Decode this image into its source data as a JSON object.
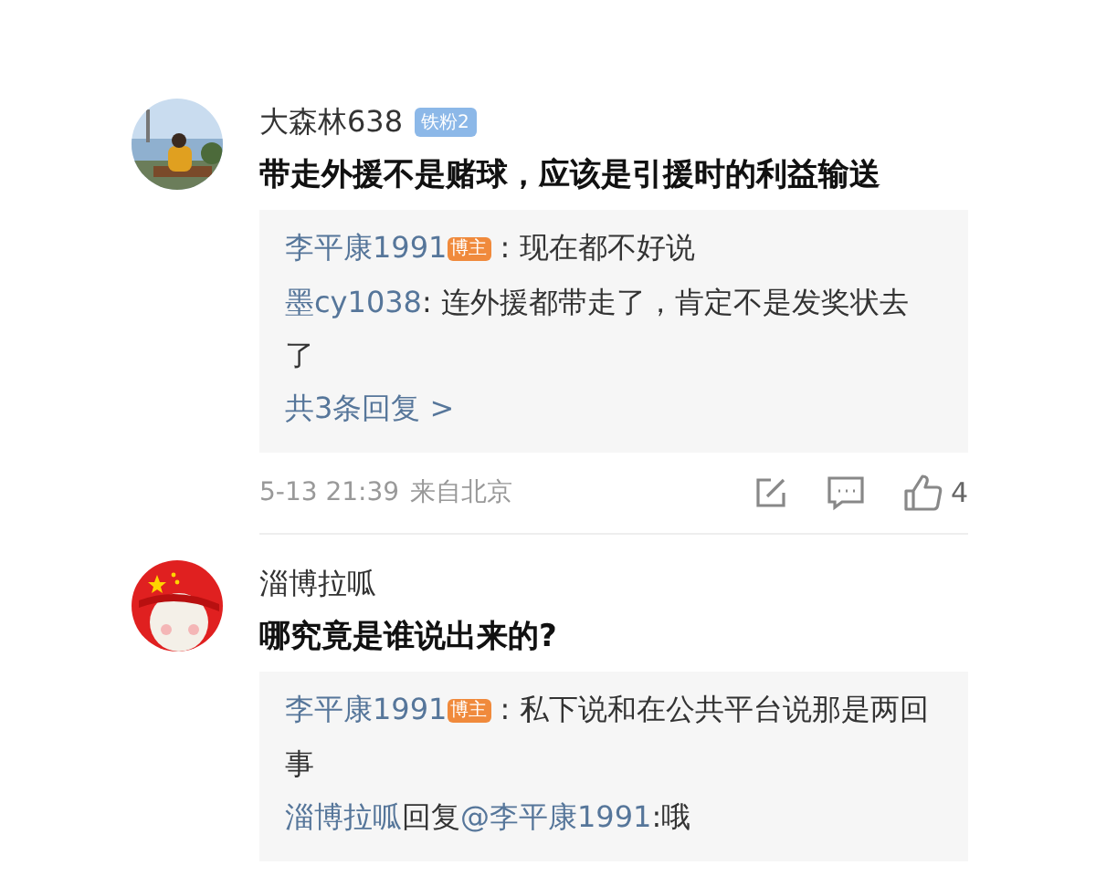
{
  "comments": [
    {
      "author": "大森林638",
      "badge": {
        "kind": "fan",
        "text": "铁粉2"
      },
      "text": "带走外援不是赌球，应该是引援时的利益输送",
      "replies": [
        {
          "segments": [
            {
              "kind": "link",
              "text": "李平康1991"
            },
            {
              "kind": "badge",
              "text": "博主"
            },
            {
              "kind": "text",
              "text": " : 现在都不好说"
            }
          ]
        },
        {
          "segments": [
            {
              "kind": "link",
              "text": "墨cy1038"
            },
            {
              "kind": "text",
              "text": ": 连外援都带走了，肯定不是发奖状去了"
            }
          ]
        }
      ],
      "more_replies": "共3条回复 >",
      "time": "5-13 21:39",
      "location": "来自北京",
      "likes": "4"
    },
    {
      "author": "淄博拉呱",
      "text": "哪究竟是谁说出来的?",
      "replies": [
        {
          "segments": [
            {
              "kind": "link",
              "text": "李平康1991"
            },
            {
              "kind": "badge",
              "text": "博主"
            },
            {
              "kind": "text",
              "text": " : 私下说和在公共平台说那是两回事"
            }
          ]
        },
        {
          "segments": [
            {
              "kind": "link",
              "text": "淄博拉呱"
            },
            {
              "kind": "text",
              "text": "回复"
            },
            {
              "kind": "link",
              "text": "@李平康1991"
            },
            {
              "kind": "text",
              "text": ":哦"
            }
          ]
        }
      ]
    }
  ]
}
